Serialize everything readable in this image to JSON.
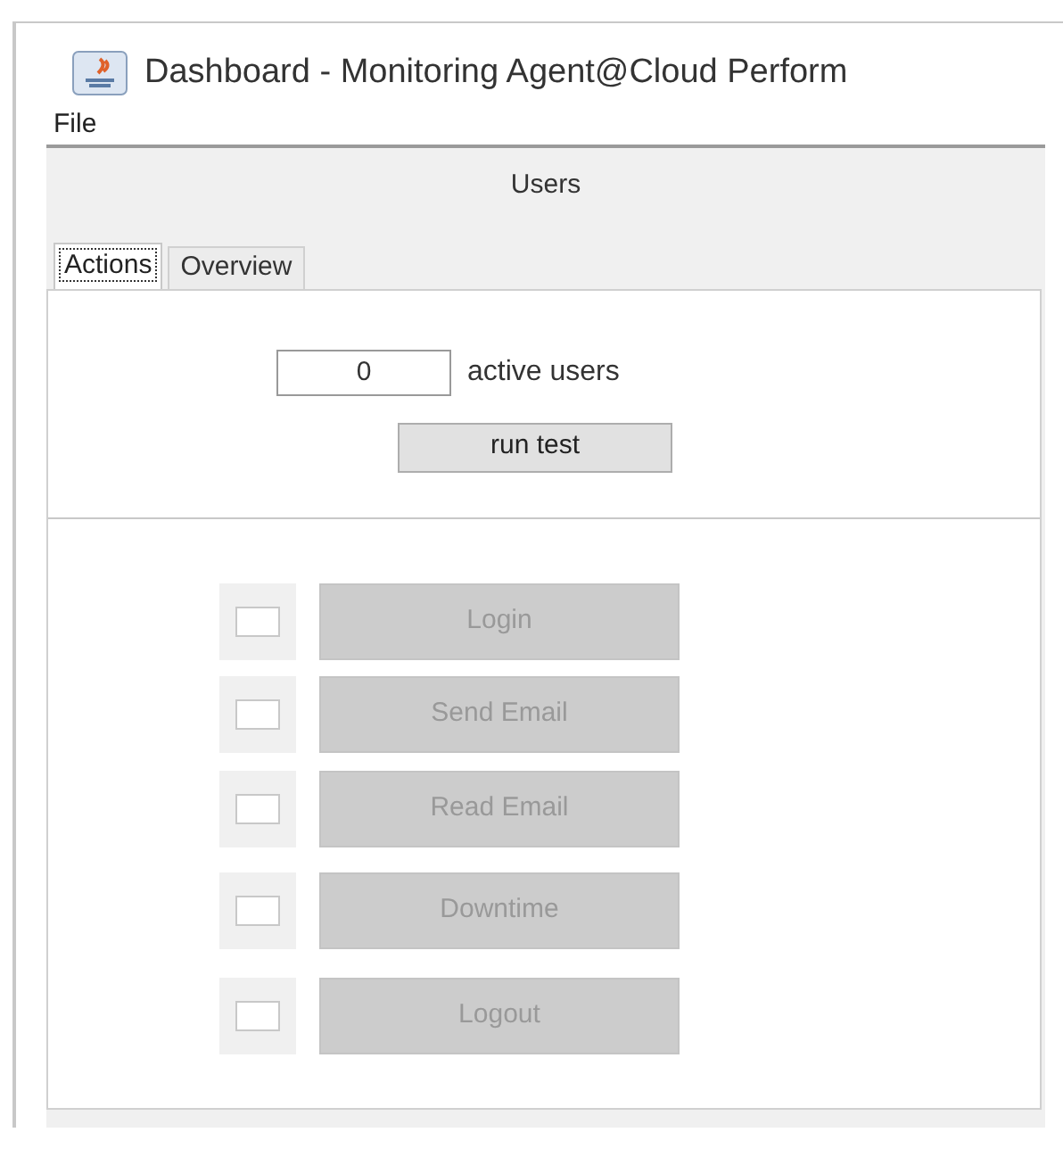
{
  "window": {
    "title": "Dashboard - Monitoring Agent@Cloud Perform"
  },
  "menu": [
    "File"
  ],
  "panel": {
    "title": "Users"
  },
  "tabs": [
    {
      "label": "Actions",
      "selected": true
    },
    {
      "label": "Overview",
      "selected": false
    }
  ],
  "users_field": {
    "value": "0",
    "label": "active users"
  },
  "run_button": {
    "label": "run test"
  },
  "actions": [
    {
      "label": "Login",
      "checked": false,
      "disabled": true
    },
    {
      "label": "Send Email",
      "checked": false,
      "disabled": true
    },
    {
      "label": "Read Email",
      "checked": false,
      "disabled": true
    },
    {
      "label": "Downtime",
      "checked": false,
      "disabled": true
    },
    {
      "label": "Logout",
      "checked": false,
      "disabled": true
    }
  ]
}
